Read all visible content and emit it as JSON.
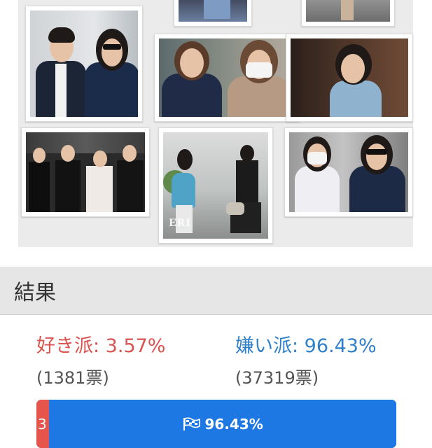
{
  "result": {
    "title": "結果",
    "like": {
      "label": "好き派: 3.57%",
      "votes": "(1381票)",
      "percent": 3.57,
      "bar_label": "3",
      "color": "#e5554b"
    },
    "dislike": {
      "label": "嫌い派: 96.43%",
      "votes": "(37319票)",
      "percent": 96.43,
      "bar_label": "96.43%",
      "color": "#1e78e4",
      "icon": "checkered-flag-icon"
    }
  },
  "gallery": {
    "watermark": "ERI"
  }
}
